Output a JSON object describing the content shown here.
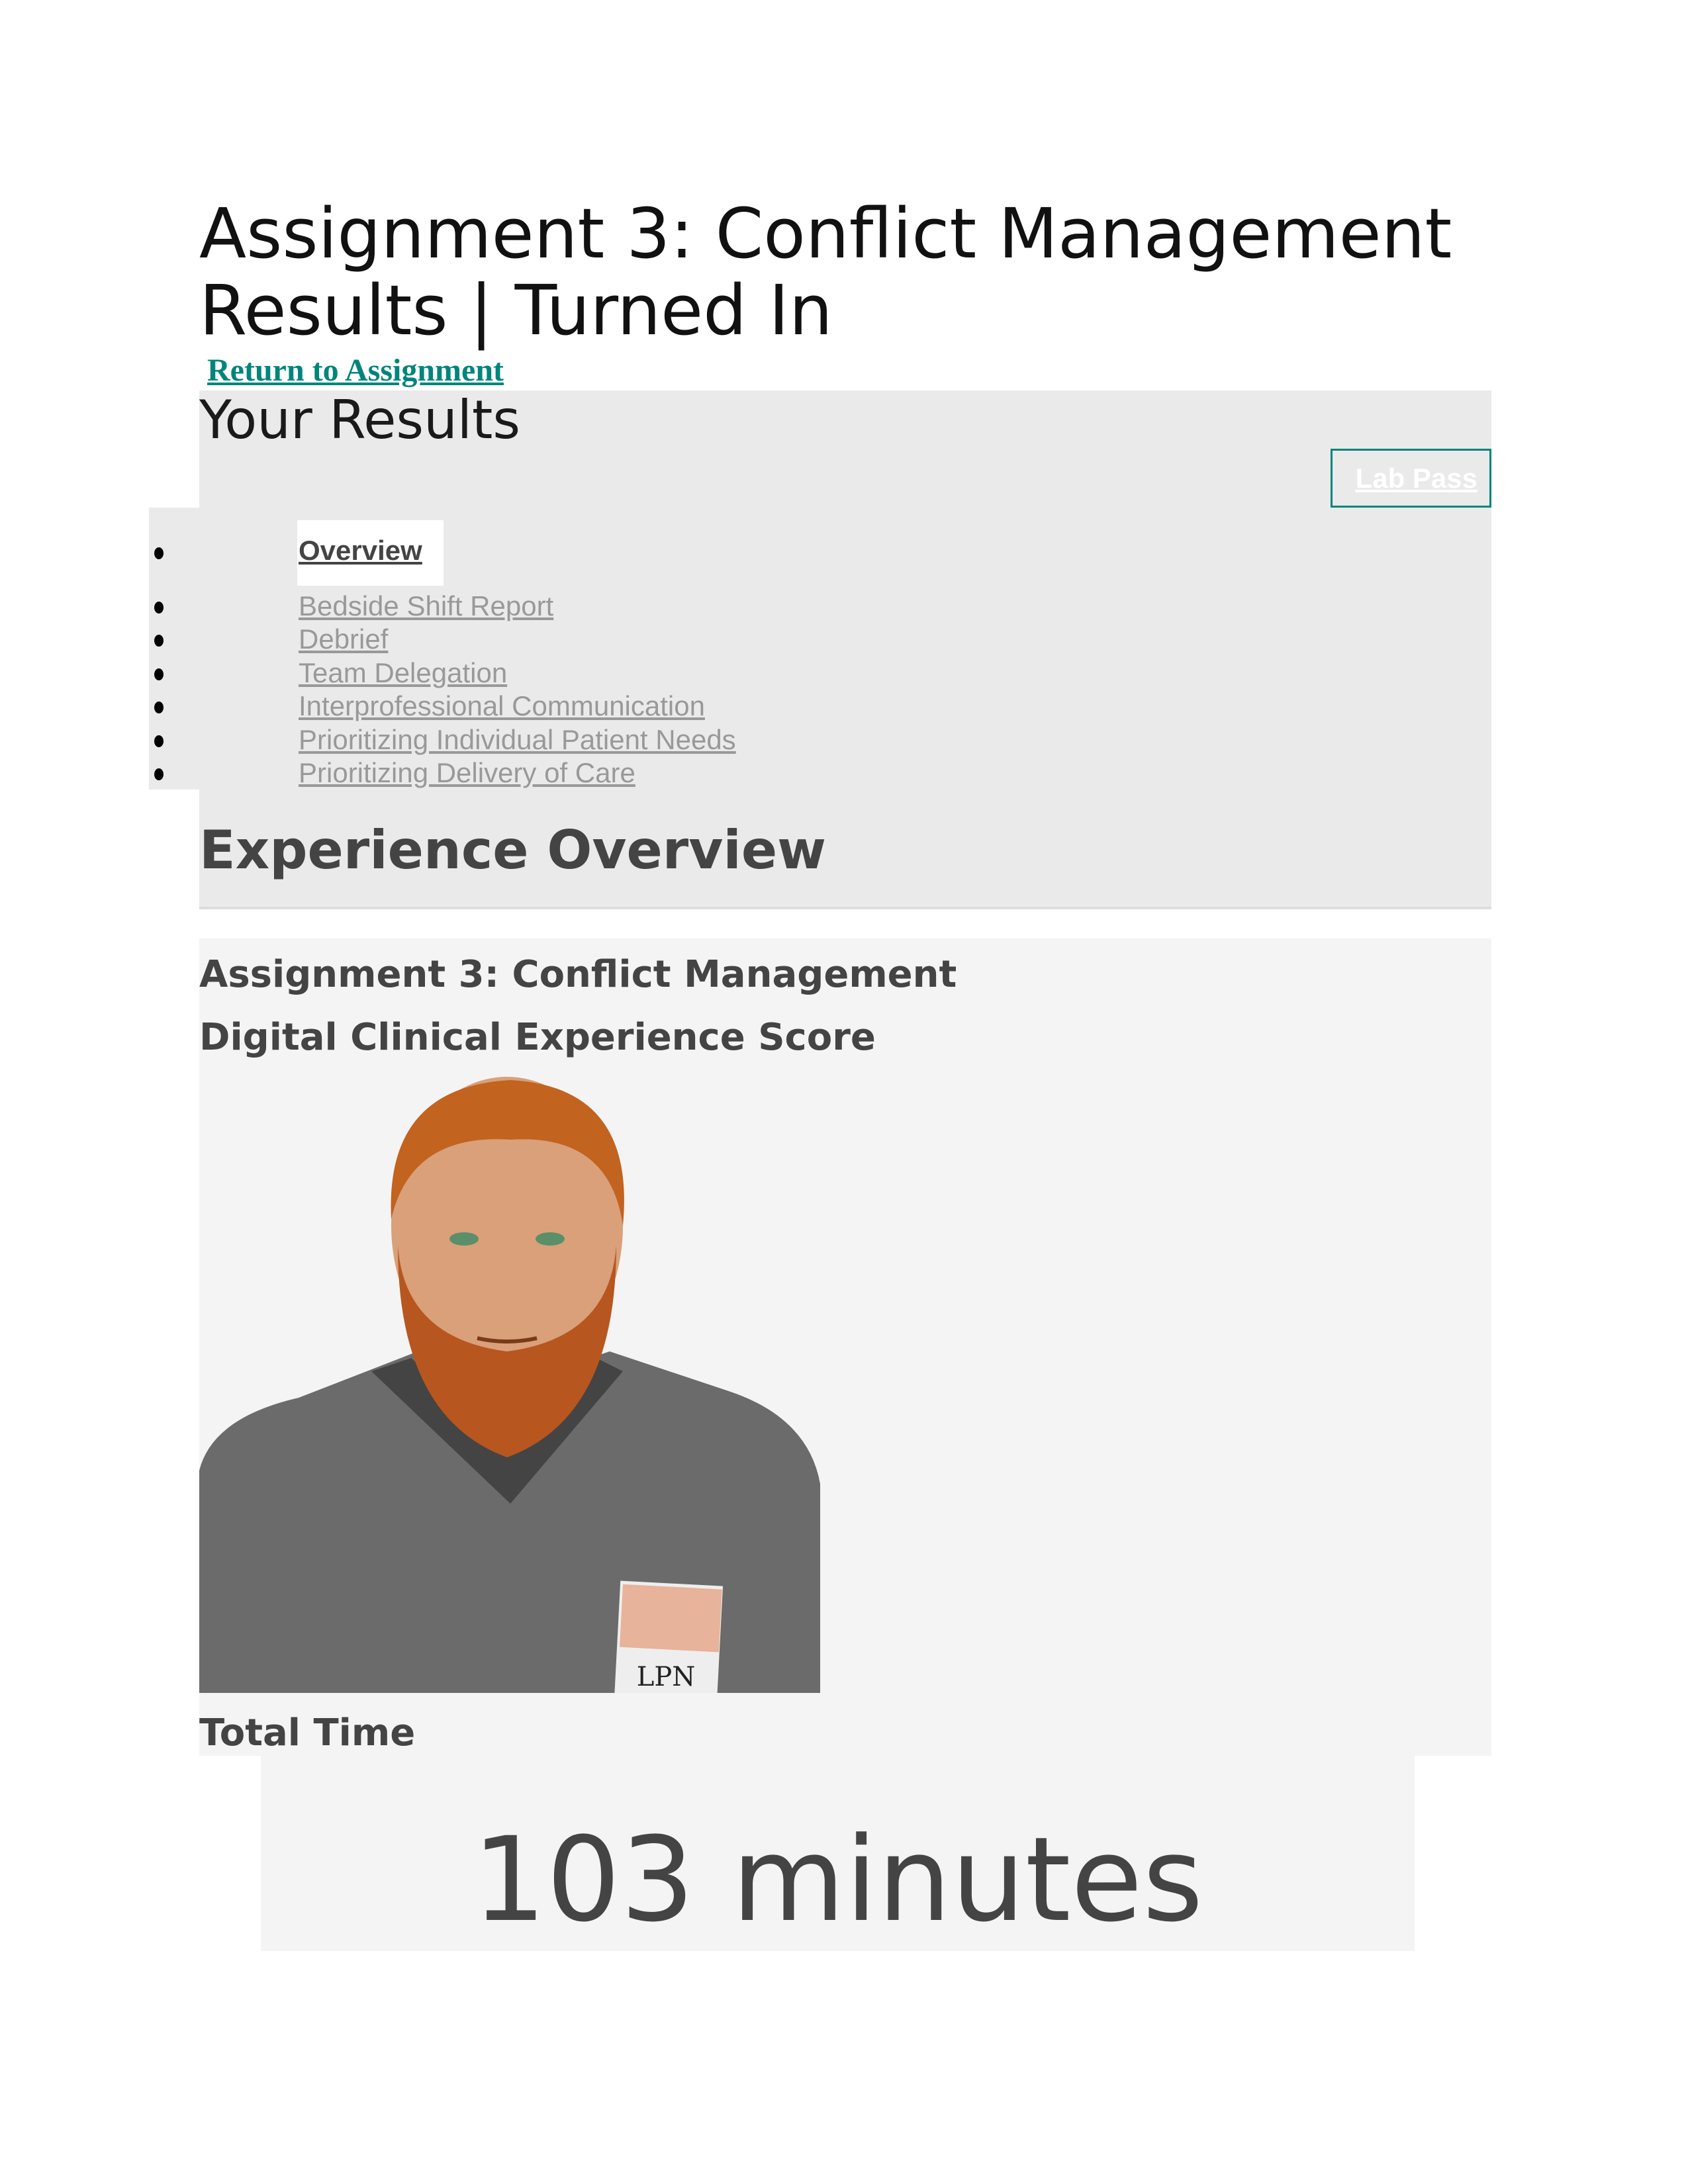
{
  "page": {
    "title": "Assignment 3: Conflict Management Results | Turned In",
    "return_link": "Return to Assignment"
  },
  "results": {
    "heading": "Your Results",
    "lab_pass_label": "Lab Pass",
    "nav": [
      {
        "label": "Overview",
        "active": true
      },
      {
        "label": "Bedside Shift Report"
      },
      {
        "label": "Debrief"
      },
      {
        "label": "Team Delegation"
      },
      {
        "label": "Interprofessional Communication"
      },
      {
        "label": "Prioritizing Individual Patient Needs"
      },
      {
        "label": "Prioritizing Delivery of Care"
      }
    ]
  },
  "overview": {
    "heading": "Experience Overview",
    "assignment_name": "Assignment 3: Conflict Management",
    "score_label": "Digital Clinical Experience Score",
    "badge_text": "LPN",
    "total_time_label": "Total Time",
    "total_time_value": "103 minutes"
  },
  "colors": {
    "accent": "#00857c",
    "text": "#444444",
    "panel": "#f4f4f4",
    "nav_bg": "#eaeaea"
  }
}
